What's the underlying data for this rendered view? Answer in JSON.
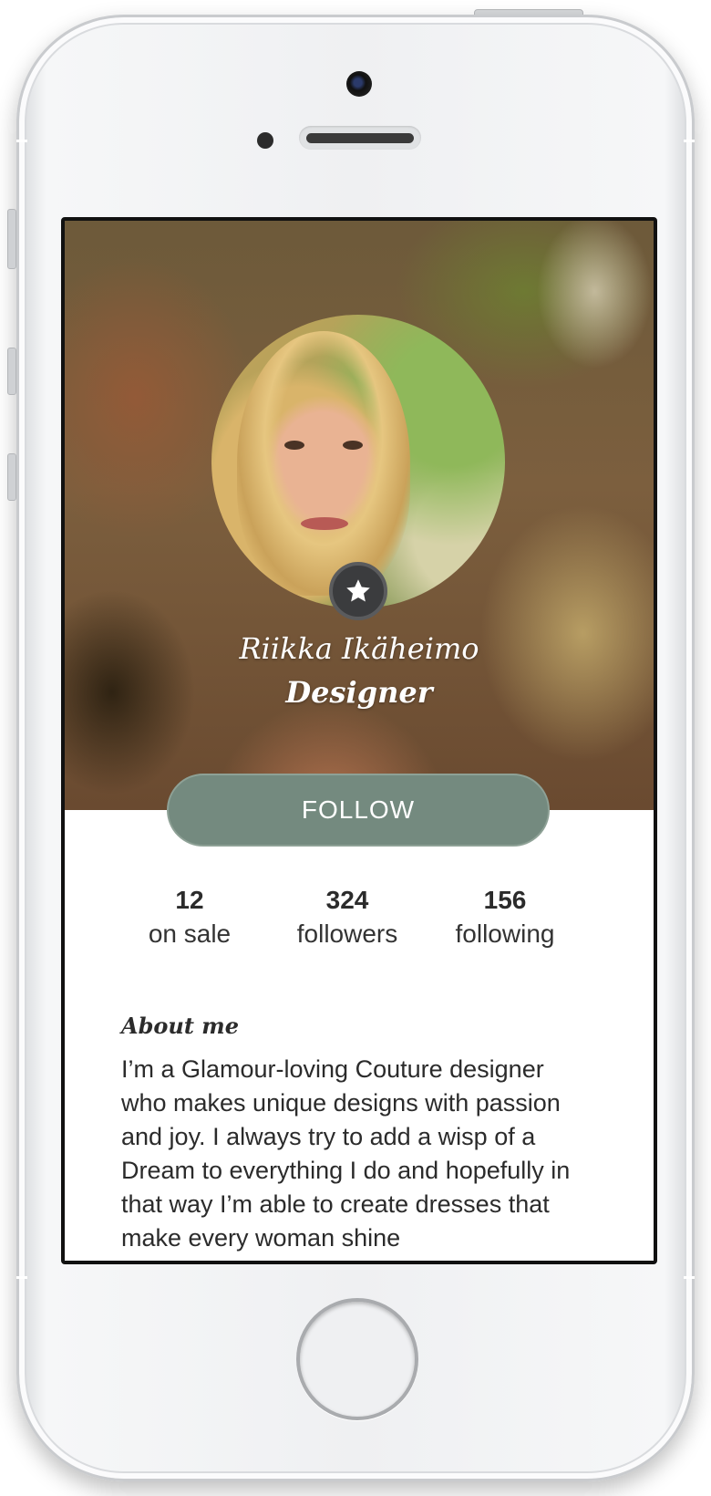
{
  "profile": {
    "name": "Riikka Ikäheimo",
    "role": "Designer",
    "follow_label": "FOLLOW"
  },
  "stats": [
    {
      "value": "12",
      "label": "on sale"
    },
    {
      "value": "324",
      "label": "followers"
    },
    {
      "value": "156",
      "label": "following"
    }
  ],
  "about": {
    "title": "About me",
    "text": "I’m a Glamour-loving Couture designer who makes unique designs with passion and joy. I always try to add a wisp of a Dream to everything I do and hopefully in that way I’m able to create dresses that make every woman shine"
  },
  "icons": {
    "badge": "star-icon"
  },
  "colors": {
    "follow_button": "#748a7f",
    "badge": "#3b3c3e",
    "text": "#2b2b2b"
  }
}
